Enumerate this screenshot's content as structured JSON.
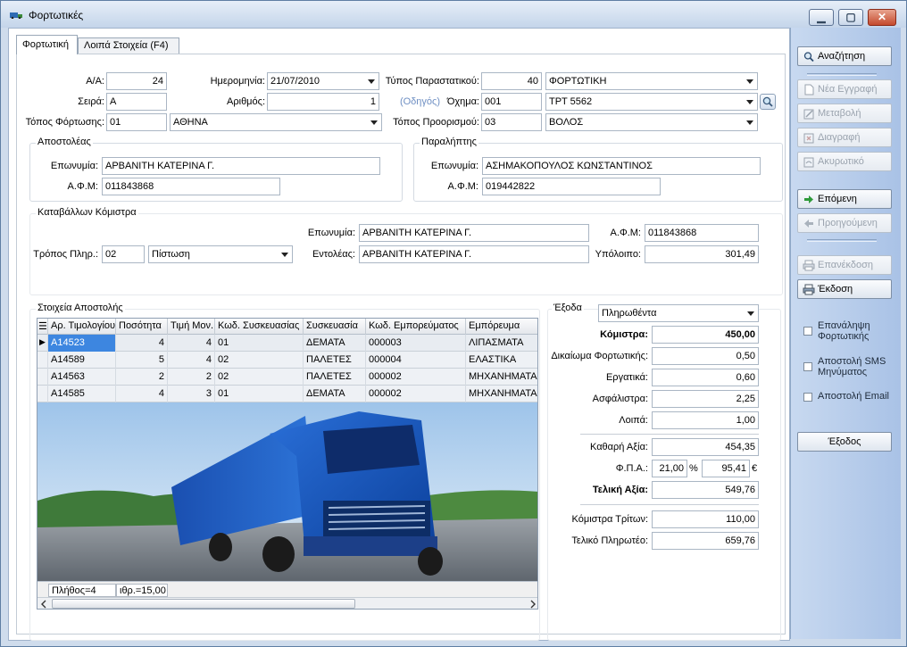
{
  "window": {
    "title": "Φορτωτικές",
    "min_label": "▁",
    "max_label": "▢",
    "close_label": "✕"
  },
  "tabs": [
    {
      "label": "Φορτωτική"
    },
    {
      "label": "Λοιπά Στοιχεία (F4)"
    }
  ],
  "header": {
    "aa_label": "Α/Α:",
    "aa_value": "24",
    "date_label": "Ημερομηνία:",
    "date_value": "21/07/2010",
    "doctype_label": "Τύπος Παραστατικού:",
    "doctype_code": "40",
    "doctype_name": "ΦΟΡΤΩΤΙΚΗ",
    "series_label": "Σειρά:",
    "series_value": "Α",
    "number_label": "Αριθμός:",
    "number_value": "1",
    "driver_label": "(Οδηγός)",
    "vehicle_label": "Όχημα:",
    "vehicle_code": "001",
    "vehicle_name": "ΤΡΤ 5562",
    "loading_label": "Τόπος Φόρτωσης:",
    "loading_code": "01",
    "loading_name": "ΑΘΗΝΑ",
    "dest_label": "Τόπος Προορισμού:",
    "dest_code": "03",
    "dest_name": "ΒΟΛΟΣ"
  },
  "sender": {
    "title": "Αποστολέας",
    "name_label": "Επωνυμία:",
    "name_value": "ΑΡΒΑΝΙΤΗ ΚΑΤΕΡΙΝΑ Γ.",
    "afm_label": "Α.Φ.Μ:",
    "afm_value": "011843868"
  },
  "receiver": {
    "title": "Παραλήπτης",
    "name_label": "Επωνυμία:",
    "name_value": "ΑΣΗΜΑΚΟΠΟΥΛΟΣ ΚΩΝΣΤΑΝΤΙΝΟΣ",
    "afm_label": "Α.Φ.Μ:",
    "afm_value": "019442822"
  },
  "payer": {
    "title": "Καταβάλλων Κόμιστρα",
    "name_label": "Επωνυμία:",
    "name_value": "ΑΡΒΑΝΙΤΗ ΚΑΤΕΡΙΝΑ Γ.",
    "afm_label": "Α.Φ.Μ:",
    "afm_value": "011843868",
    "paymode_label": "Τρόπος Πληρ.:",
    "paymode_code": "02",
    "paymode_name": "Πίστωση",
    "order_label": "Εντολέας:",
    "order_value": "ΑΡΒΑΝΙΤΗ ΚΑΤΕΡΙΝΑ Γ.",
    "balance_label": "Υπόλοιπο:",
    "balance_value": "301,49"
  },
  "items": {
    "title": "Στοιχεία Αποστολής",
    "columns": [
      "Αρ. Τιμολογίου",
      "Ποσότητα",
      "Τιμή Μον.",
      "Κωδ. Συσκευασίας",
      "Συσκευασία",
      "Κωδ. Εμπορεύματος",
      "Εμπόρευμα"
    ],
    "rows": [
      [
        "Α14523",
        "4",
        "4",
        "01",
        "ΔΕΜΑΤΑ",
        "000003",
        "ΛΙΠΑΣΜΑΤΑ"
      ],
      [
        "Α14589",
        "5",
        "4",
        "02",
        "ΠΑΛΕΤΕΣ",
        "000004",
        "ΕΛΑΣΤΙΚΑ"
      ],
      [
        "Α14563",
        "2",
        "2",
        "02",
        "ΠΑΛΕΤΕΣ",
        "000002",
        "ΜΗΧΑΝΗΜΑΤΑ"
      ],
      [
        "Α14585",
        "4",
        "3",
        "01",
        "ΔΕΜΑΤΑ",
        "000002",
        "ΜΗΧΑΝΗΜΑΤΑ"
      ]
    ],
    "count": "Πλήθος=4",
    "sum": "ιθρ.=15,00"
  },
  "expenses": {
    "title": "Έξοδα",
    "mode": "Πληρωθέντα",
    "freight_label": "Κόμιστρα:",
    "freight_value": "450,00",
    "right_label": "Δικαίωμα Φορτωτικής:",
    "right_value": "0,50",
    "labor_label": "Εργατικά:",
    "labor_value": "0,60",
    "insurance_label": "Ασφάλιστρα:",
    "insurance_value": "2,25",
    "other_label": "Λοιπά:",
    "other_value": "1,00",
    "net_label": "Καθαρή Αξία:",
    "net_value": "454,35",
    "vat_label": "Φ.Π.Α.:",
    "vat_pct": "21,00",
    "vat_pct_sign": "%",
    "vat_value": "95,41",
    "currency": "€",
    "total_label": "Τελική Αξία:",
    "total_value": "549,76",
    "third_label": "Κόμιστρα Τρίτων:",
    "third_value": "110,00",
    "payable_label": "Τελικό Πληρωτέο:",
    "payable_value": "659,76"
  },
  "sidebar": {
    "search": "Αναζήτηση",
    "new": "Νέα Εγγραφή",
    "edit": "Μεταβολή",
    "delete": "Διαγραφή",
    "cancel": "Ακυρωτικό",
    "next": "Επόμενη",
    "prev": "Προηγούμενη",
    "reissue": "Επανέκδοση",
    "issue": "Έκδοση",
    "repeat": "Επανάληψη Φορτωτικής",
    "sms": "Αποστολή SMS Μηνύματος",
    "email": "Αποστολή Email",
    "exit": "Έξοδος"
  },
  "colors": {
    "accent": "#3a78d6",
    "selected": "#3d86e0",
    "sidebar": "#b7cdeb",
    "disabled": "#9aa3ae"
  }
}
